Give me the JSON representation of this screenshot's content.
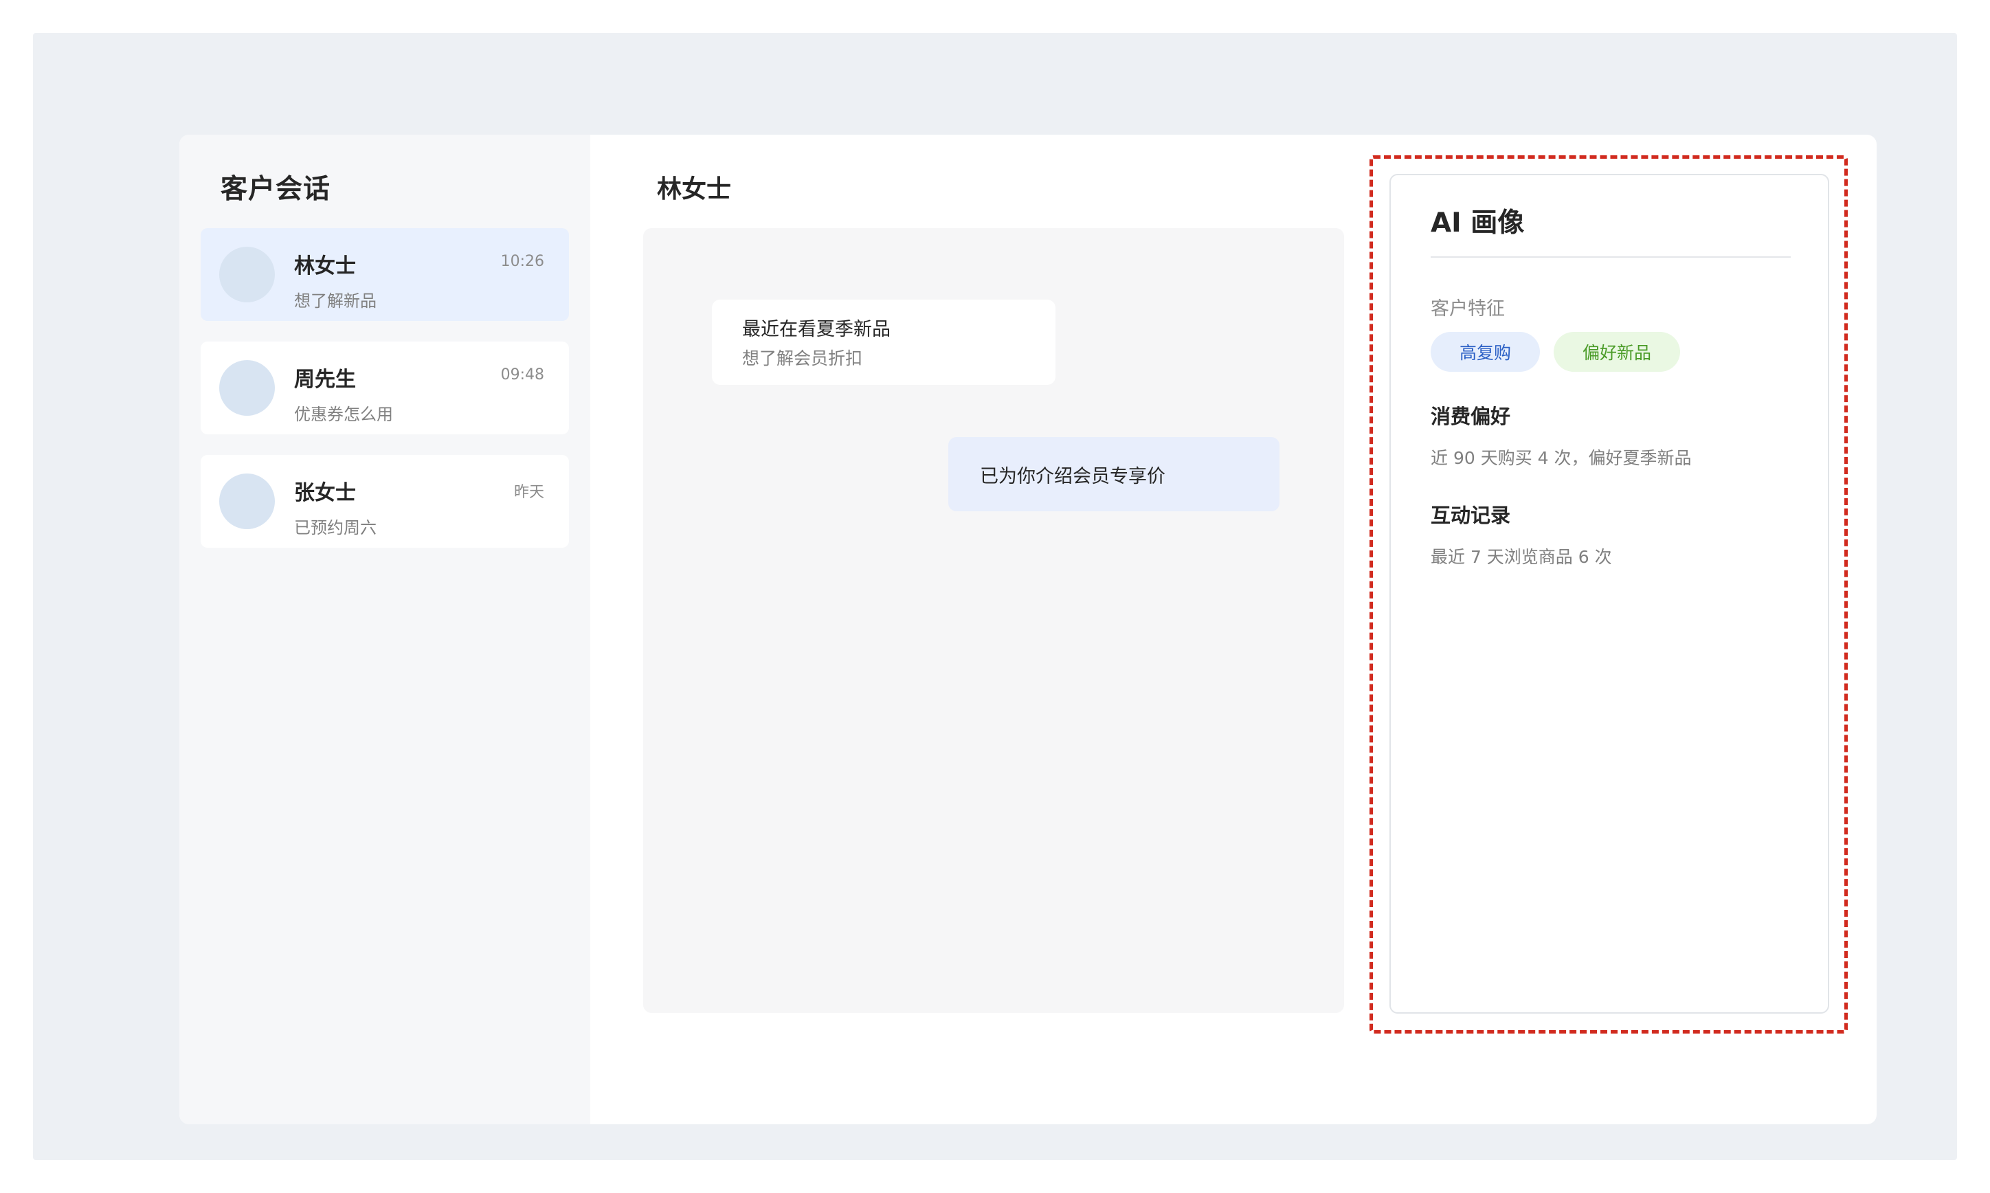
{
  "sidebar": {
    "title": "客户会话",
    "conversations": [
      {
        "name": "林女士",
        "time": "10:26",
        "preview": "想了解新品",
        "active": true
      },
      {
        "name": "周先生",
        "time": "09:48",
        "preview": "优惠券怎么用",
        "active": false
      },
      {
        "name": "张女士",
        "time": "昨天",
        "preview": "已预约周六",
        "active": false
      }
    ]
  },
  "chat": {
    "title": "林女士",
    "messages": {
      "incoming": {
        "line1": "最近在看夏季新品",
        "line2": "想了解会员折扣"
      },
      "outgoing": {
        "text": "已为你介绍会员专享价"
      }
    }
  },
  "ai_panel": {
    "title": "AI 画像",
    "traits_label": "客户特征",
    "tags": [
      {
        "label": "高复购",
        "color": "#2a5fc5"
      },
      {
        "label": "偏好新品",
        "color": "#4a9b27"
      }
    ],
    "preference": {
      "heading": "消费偏好",
      "text": "近 90 天购买 4 次，偏好夏季新品"
    },
    "interaction": {
      "heading": "互动记录",
      "text": "最近 7 天浏览商品 6 次"
    }
  },
  "colors": {
    "highlight": "#d12a1e",
    "active_item": "#e8f0fe",
    "outgoing_bubble": "#e8eefc"
  }
}
